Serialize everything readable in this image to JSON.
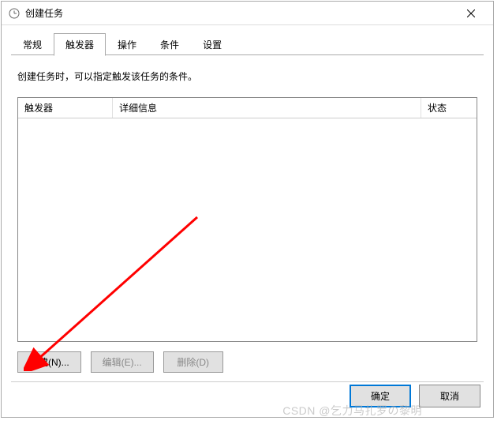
{
  "titlebar": {
    "title": "创建任务"
  },
  "tabs": {
    "items": [
      {
        "label": "常规"
      },
      {
        "label": "触发器"
      },
      {
        "label": "操作"
      },
      {
        "label": "条件"
      },
      {
        "label": "设置"
      }
    ],
    "active_index": 1
  },
  "content": {
    "description": "创建任务时，可以指定触发该任务的条件。"
  },
  "table": {
    "columns": {
      "col1": "触发器",
      "col2": "详细信息",
      "col3": "状态"
    },
    "rows": []
  },
  "buttons": {
    "new": "新建(N)...",
    "edit": "编辑(E)...",
    "delete": "删除(D)"
  },
  "dialog_buttons": {
    "ok": "确定",
    "cancel": "取消"
  },
  "watermark": "CSDN @乞力马扎罗の黎明"
}
